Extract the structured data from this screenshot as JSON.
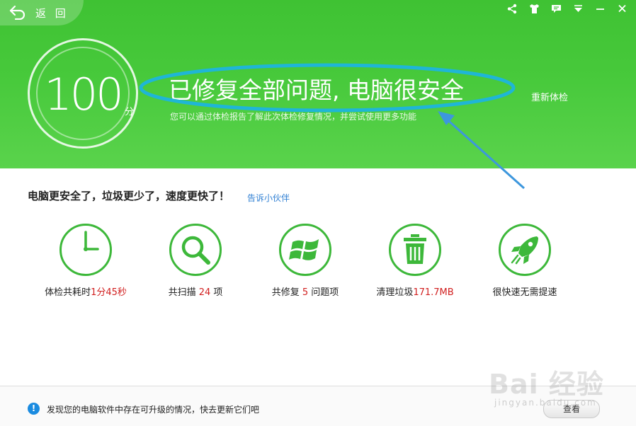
{
  "header": {
    "back_label": "返 回",
    "score": "100",
    "score_unit": "分",
    "headline": "已修复全部问题, 电脑很安全",
    "subline": "您可以通过体检报告了解此次体检修复情况，并尝试使用更多功能",
    "recheck": "重新体检"
  },
  "window_controls": [
    "share-icon",
    "tshirt-skin-icon",
    "feedback-icon",
    "menu-icon",
    "minimize-icon",
    "close-icon"
  ],
  "summary": {
    "text": "电脑更安全了，垃圾更少了，速度更快了！",
    "share_link": "告诉小伙伴"
  },
  "stats": [
    {
      "icon": "clock-icon",
      "prefix": "体检共耗时",
      "value": "1分45秒",
      "suffix": ""
    },
    {
      "icon": "magnifier-icon",
      "prefix": "共扫描 ",
      "value": "24",
      "suffix": " 项"
    },
    {
      "icon": "windows-logo-icon",
      "prefix": "共修复 ",
      "value": "5",
      "suffix": " 问题项"
    },
    {
      "icon": "trash-icon",
      "prefix": "清理垃圾",
      "value": "171.7MB",
      "suffix": ""
    },
    {
      "icon": "rocket-icon",
      "prefix": "很快速无需提速",
      "value": "",
      "suffix": ""
    }
  ],
  "footer": {
    "message": "发现您的电脑软件中存在可升级的情况，快去更新它们吧",
    "view_button": "查看"
  },
  "watermark": {
    "text": "Bai 经验",
    "sub": "jingyan.baidu.com"
  },
  "colors": {
    "brand_green": "#44c638",
    "stat_green": "#3db83a",
    "highlight_value": "#d11f1f",
    "annotation": "#1fb6d6",
    "link": "#2f7fd3"
  }
}
